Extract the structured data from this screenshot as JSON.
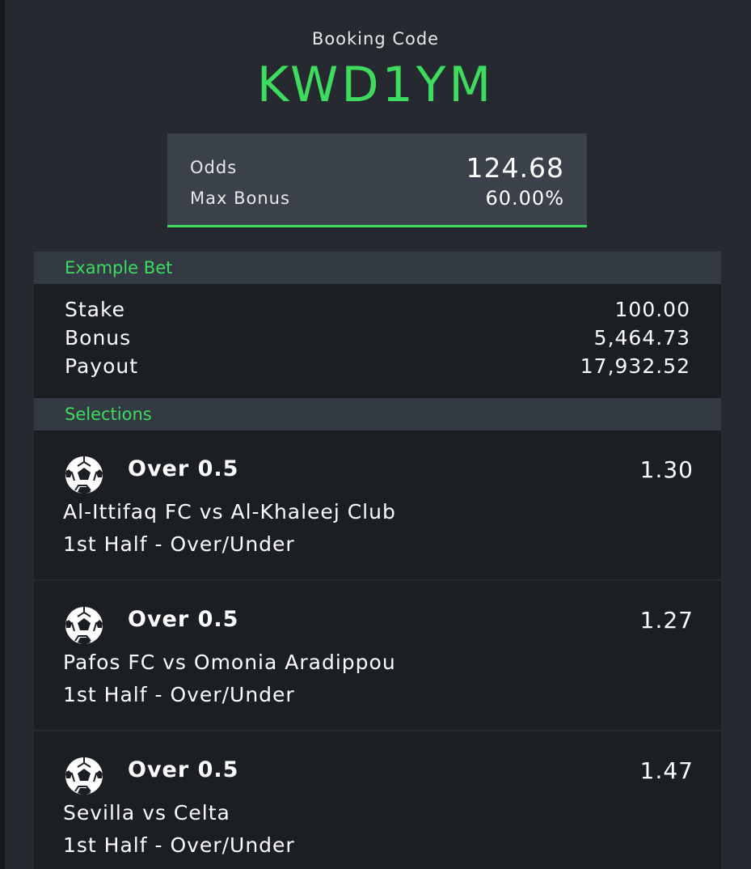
{
  "header": {
    "booking_label": "Booking Code",
    "booking_code": "KWD1YM"
  },
  "summary": {
    "odds_label": "Odds",
    "odds_value": "124.68",
    "bonus_label": "Max Bonus",
    "bonus_value": "60.00%"
  },
  "example_bet": {
    "title": "Example Bet",
    "rows": [
      {
        "label": "Stake",
        "value": "100.00"
      },
      {
        "label": "Bonus",
        "value": "5,464.73"
      },
      {
        "label": "Payout",
        "value": "17,932.52"
      }
    ]
  },
  "selections": {
    "title": "Selections",
    "items": [
      {
        "icon": "soccer-ball-icon",
        "pick": "Over 0.5",
        "odds": "1.30",
        "match": "Al-Ittifaq FC vs Al-Khaleej Club",
        "market": "1st Half - Over/Under"
      },
      {
        "icon": "soccer-ball-icon",
        "pick": "Over 0.5",
        "odds": "1.27",
        "match": "Pafos FC vs Omonia Aradippou",
        "market": "1st Half - Over/Under"
      },
      {
        "icon": "soccer-ball-icon",
        "pick": "Over 0.5",
        "odds": "1.47",
        "match": "Sevilla vs Celta",
        "market": "1st Half - Over/Under"
      }
    ]
  },
  "colors": {
    "accent": "#3ddc5f",
    "background": "#262a30",
    "panel": "#1b1e23",
    "section_header": "#333a43",
    "odds_box": "#3b414a"
  }
}
